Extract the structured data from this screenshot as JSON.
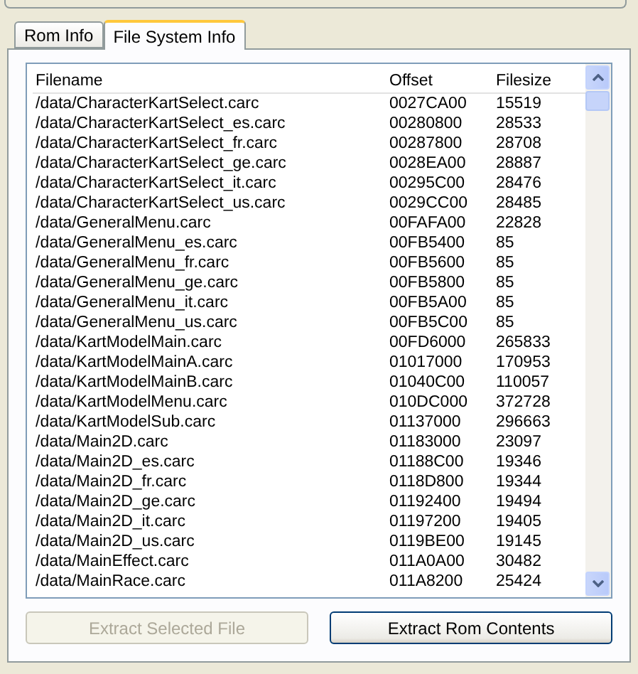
{
  "tabs": [
    {
      "label": "Rom Info",
      "selected": false
    },
    {
      "label": "File System Info",
      "selected": true
    }
  ],
  "table": {
    "columns": [
      "Filename",
      "Offset",
      "Filesize"
    ],
    "rows": [
      [
        "/data/CharacterKartSelect.carc",
        "0027CA00",
        "15519"
      ],
      [
        "/data/CharacterKartSelect_es.carc",
        "00280800",
        "28533"
      ],
      [
        "/data/CharacterKartSelect_fr.carc",
        "00287800",
        "28708"
      ],
      [
        "/data/CharacterKartSelect_ge.carc",
        "0028EA00",
        "28887"
      ],
      [
        "/data/CharacterKartSelect_it.carc",
        "00295C00",
        "28476"
      ],
      [
        "/data/CharacterKartSelect_us.carc",
        "0029CC00",
        "28485"
      ],
      [
        "/data/GeneralMenu.carc",
        "00FAFA00",
        "22828"
      ],
      [
        "/data/GeneralMenu_es.carc",
        "00FB5400",
        "85"
      ],
      [
        "/data/GeneralMenu_fr.carc",
        "00FB5600",
        "85"
      ],
      [
        "/data/GeneralMenu_ge.carc",
        "00FB5800",
        "85"
      ],
      [
        "/data/GeneralMenu_it.carc",
        "00FB5A00",
        "85"
      ],
      [
        "/data/GeneralMenu_us.carc",
        "00FB5C00",
        "85"
      ],
      [
        "/data/KartModelMain.carc",
        "00FD6000",
        "265833"
      ],
      [
        "/data/KartModelMainA.carc",
        "01017000",
        "170953"
      ],
      [
        "/data/KartModelMainB.carc",
        "01040C00",
        "110057"
      ],
      [
        "/data/KartModelMenu.carc",
        "010DC000",
        "372728"
      ],
      [
        "/data/KartModelSub.carc",
        "01137000",
        "296663"
      ],
      [
        "/data/Main2D.carc",
        "01183000",
        "23097"
      ],
      [
        "/data/Main2D_es.carc",
        "01188C00",
        "19346"
      ],
      [
        "/data/Main2D_fr.carc",
        "0118D800",
        "19344"
      ],
      [
        "/data/Main2D_ge.carc",
        "01192400",
        "19494"
      ],
      [
        "/data/Main2D_it.carc",
        "01197200",
        "19405"
      ],
      [
        "/data/Main2D_us.carc",
        "0119BE00",
        "19145"
      ],
      [
        "/data/MainEffect.carc",
        "011A0A00",
        "30482"
      ],
      [
        "/data/MainRace.carc",
        "011A8200",
        "25424"
      ]
    ]
  },
  "buttons": [
    {
      "label": "Extract Selected File",
      "disabled": true
    },
    {
      "label": "Extract Rom Contents",
      "disabled": false
    }
  ]
}
